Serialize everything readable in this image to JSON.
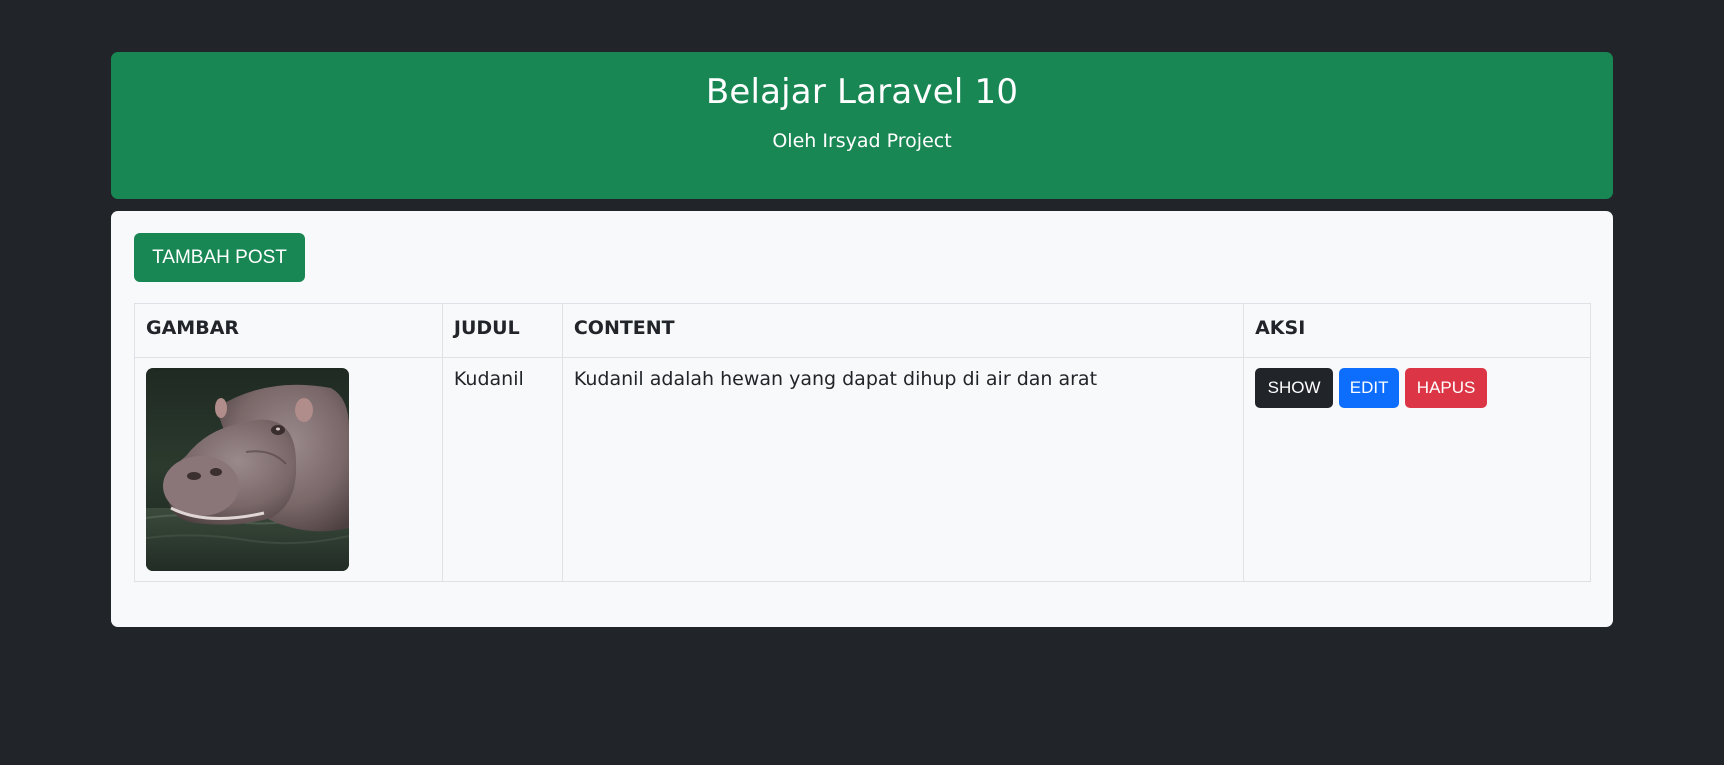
{
  "header": {
    "title": "Belajar Laravel 10",
    "subtitle": "Oleh Irsyad Project"
  },
  "toolbar": {
    "add_label": "TAMBAH POST"
  },
  "table": {
    "columns": [
      "GAMBAR",
      "JUDUL",
      "CONTENT",
      "AKSI"
    ],
    "rows": [
      {
        "image_icon": "hippo-photo",
        "title": "Kudanil",
        "content": "Kudanil adalah hewan yang dapat dihup di air dan arat",
        "actions": {
          "show": "SHOW",
          "edit": "EDIT",
          "delete": "HAPUS"
        }
      }
    ]
  },
  "colors": {
    "background": "#212529",
    "primary_green": "#198754",
    "show": "#212529",
    "edit": "#0d6efd",
    "delete": "#dc3545"
  }
}
